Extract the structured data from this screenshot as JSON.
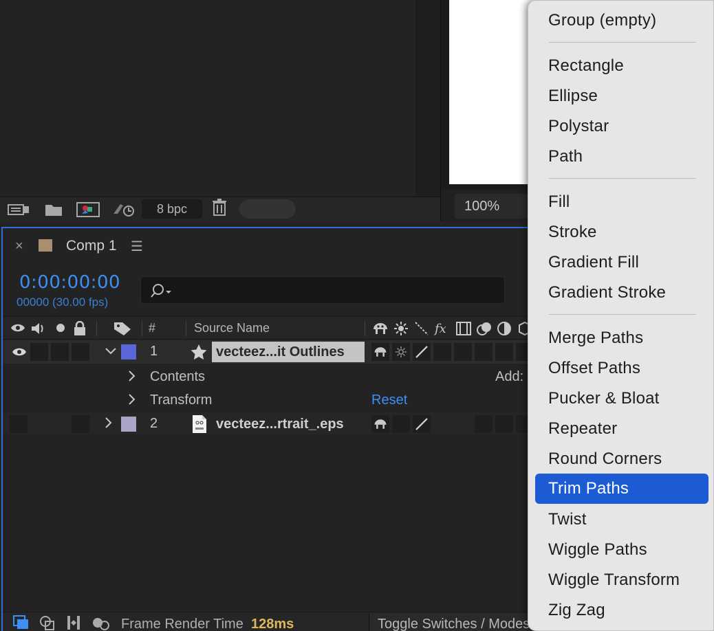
{
  "project": {
    "bpc_label": "8 bpc"
  },
  "viewer": {
    "zoom": "100%"
  },
  "timeline": {
    "tab_title": "Comp 1",
    "tab_close": "×",
    "tab_menu": "☰",
    "timecode": "0:00:00:00",
    "frame_fps": "00000 (30.00 fps)",
    "col_number": "#",
    "col_source_name": "Source Name",
    "layers": [
      {
        "number": "1",
        "name": "vecteez...it Outlines",
        "label_color": "#5b66d8",
        "selected": true
      },
      {
        "number": "2",
        "name": "vecteez...rtrait_.eps",
        "label_color": "#a9a4c8",
        "selected": false
      }
    ],
    "sub_rows": {
      "contents": "Contents",
      "transform": "Transform",
      "reset": "Reset",
      "add": "Add:"
    },
    "footer": {
      "frame_render_label": "Frame Render Time",
      "frame_render_value": "128ms",
      "toggle_label": "Toggle Switches / Modes"
    }
  },
  "menu": {
    "groups": [
      [
        "Group (empty)"
      ],
      [
        "Rectangle",
        "Ellipse",
        "Polystar",
        "Path"
      ],
      [
        "Fill",
        "Stroke",
        "Gradient Fill",
        "Gradient Stroke"
      ],
      [
        "Merge Paths",
        "Offset Paths",
        "Pucker & Bloat",
        "Repeater",
        "Round Corners",
        "Trim Paths",
        "Twist",
        "Wiggle Paths",
        "Wiggle Transform",
        "Zig Zag"
      ]
    ],
    "active_item": "Trim Paths"
  },
  "colors": {
    "accent_blue": "#3b8ff5",
    "menu_highlight": "#1d5bd4",
    "render_time": "#e0b75a"
  }
}
